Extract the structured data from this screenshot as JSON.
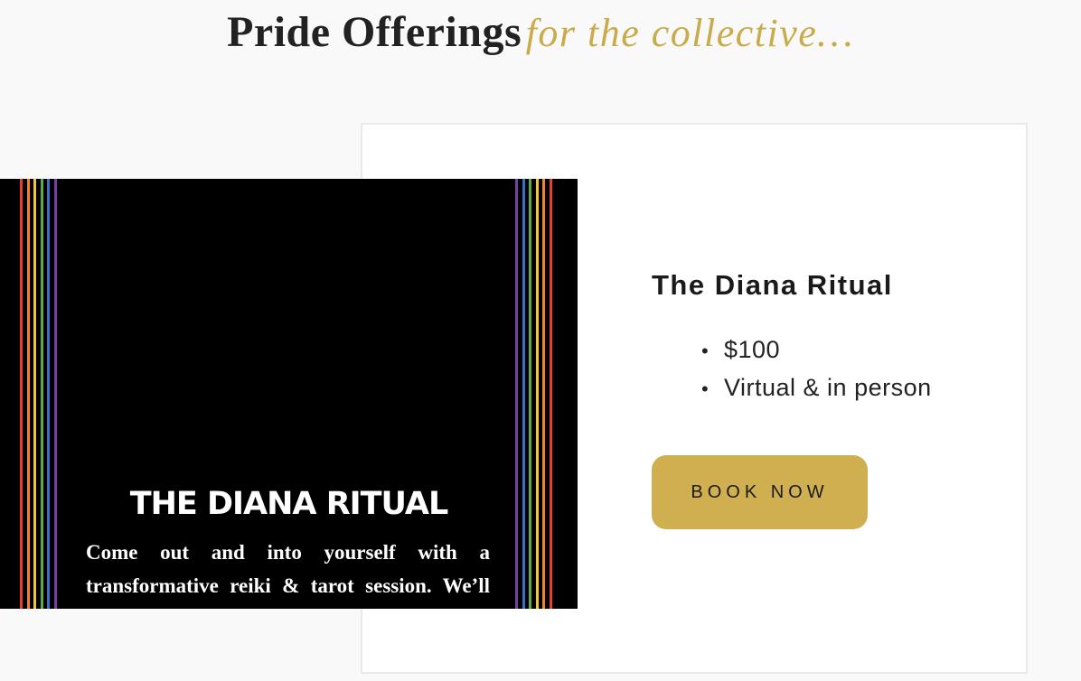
{
  "heading": {
    "main": "Pride Offerings",
    "sub": "for the collective…"
  },
  "banner": {
    "title": "THE DIANA RITUAL",
    "description": "Come out and into yourself with a transformative reiki & tarot session. We’ll close the door to all that doesn’t serve you and usher in protection, love, & spiritual insights.",
    "stripe_colors": [
      "#e3402f",
      "#f0832c",
      "#f3c63a",
      "#5bab48",
      "#3a6fc4",
      "#7a3fa3"
    ]
  },
  "offer": {
    "title": "The Diana Ritual",
    "details": [
      "$100",
      "Virtual & in person"
    ],
    "button_label": "BOOK NOW"
  },
  "colors": {
    "accent": "#cfaf4f",
    "heading_accent": "#c9ab4a",
    "background": "#f9f9f9"
  }
}
